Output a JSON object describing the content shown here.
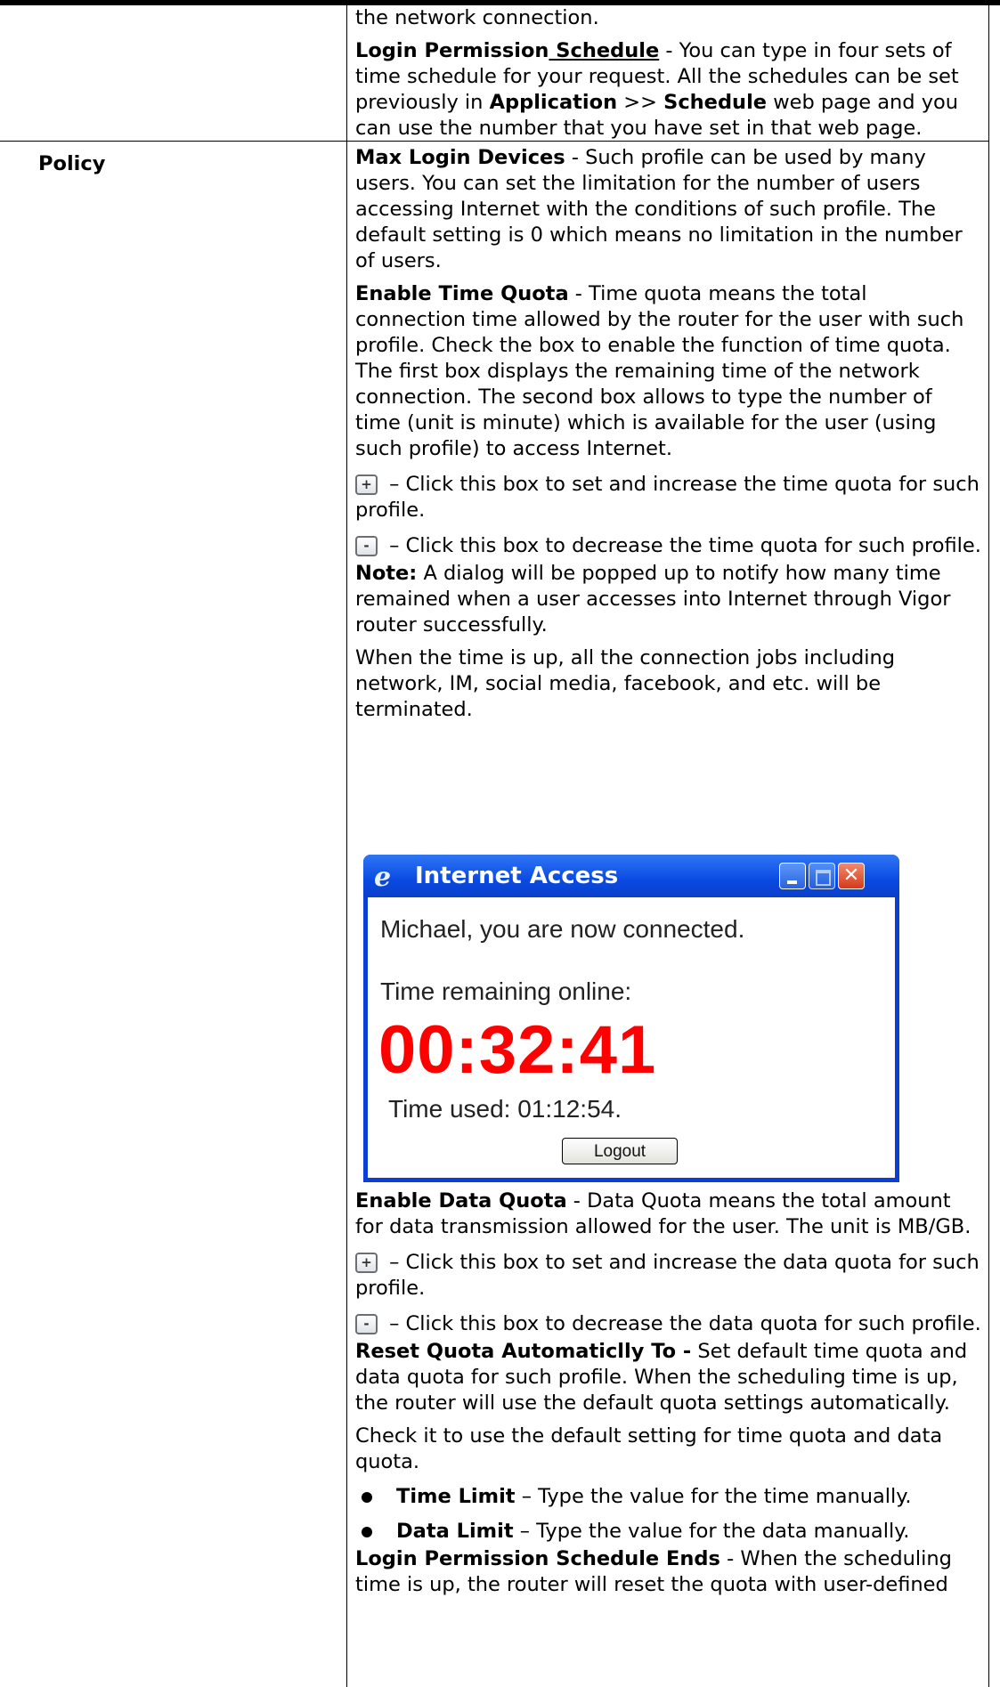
{
  "continuation": {
    "connection_tail": "the network connection.",
    "lps_term_a": "Login Permission",
    "lps_term_b": " Schedule",
    "lps_text": " - You can type in four sets of time schedule for your request. All the schedules can be set previously in ",
    "lps_app": "Application",
    "lps_gt": " >> ",
    "lps_sched": "Schedule",
    "lps_text2": " web page and you can use the number that you have set in that web page."
  },
  "policy": {
    "label": "Policy",
    "max_login_term": "Max Login Devices",
    "max_login_text": " - Such profile can be used by many users. You can set the limitation for the number of users accessing Internet with the conditions of such profile. The default setting is 0 which means no limitation in the number of users.",
    "time_quota_term": "Enable Time Quota",
    "time_quota_text": " - Time quota means the total connection time allowed by the router for the user with such profile. Check the box to enable the function of time quota. The first box displays the remaining time of the network connection. The second box allows to type the number of time (unit is minute) which is available for the user (using such profile) to access Internet.",
    "plus_symbol": "+",
    "minus_symbol": "-",
    "time_plus_text": " – Click this box to set and increase the time quota for such profile.",
    "time_minus_text": " – Click this box to decrease the time quota for such profile.",
    "note_term": "Note:",
    "note_text": " A dialog will be popped up to notify how many time remained when a user accesses into Internet through Vigor router successfully.",
    "time_up_text": "When the time is up, all the connection jobs including network, IM, social media, facebook, and etc. will be terminated.",
    "data_quota_term": "Enable Data Quota",
    "data_quota_text": " - Data Quota means the total amount for data transmission allowed for the user. The unit is MB/GB.",
    "data_plus_text": " – Click this box to set and increase the data quota for such profile.",
    "data_minus_text": " – Click this box to decrease the data quota for such profile.",
    "reset_term": "Reset Quota Automaticlly To -",
    "reset_text": " Set default time quota and data quota for such profile. When the scheduling time is up, the router will use the default quota settings automatically.",
    "check_text": "Check it to use the default setting for time quota and data quota.",
    "bullets": [
      {
        "term": "Time Limit",
        "text": " – Type the value for the time manually."
      },
      {
        "term": "Data Limit",
        "text": " – Type the value for the data manually."
      }
    ],
    "lpse_term": "Login Permission Schedule Ends",
    "lpse_text": " - When the scheduling time is up, the router will reset the quota with user-defined"
  },
  "dialog": {
    "title": "Internet Access",
    "icon": "ie-icon",
    "connected": "Michael, you are now connected.",
    "remaining_label": "Time remaining online:",
    "timer": "00:32:41",
    "used": "Time used: 01:12:54.",
    "logout": "Logout",
    "close_glyph": "✕"
  }
}
